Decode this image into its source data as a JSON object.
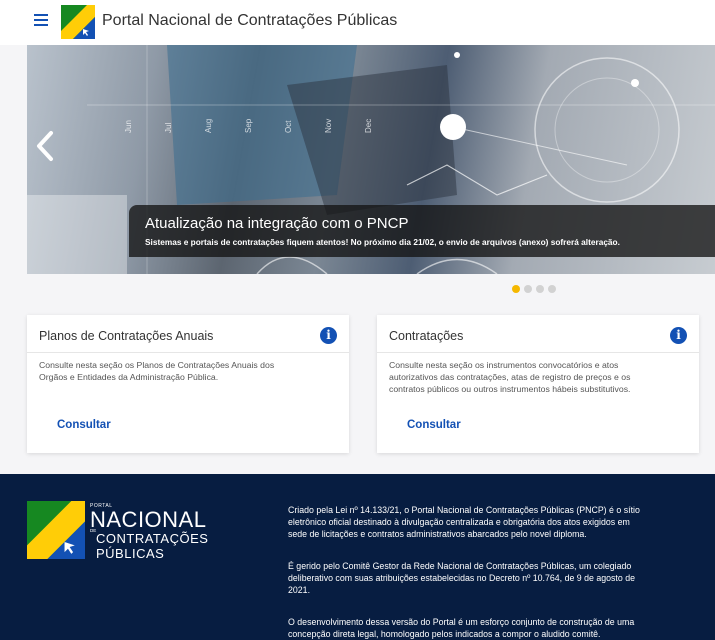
{
  "header": {
    "menu_icon": "hamburger-menu-icon",
    "logo_icon": "pncp-logo-icon",
    "title": "Portal Nacional de Contratações Públicas"
  },
  "carousel": {
    "month_labels": [
      "Jun",
      "Jul",
      "Aug",
      "Sep",
      "Oct",
      "Nov",
      "Dec"
    ],
    "slide_title": "Atualização na integração com o PNCP",
    "slide_text": "Sistemas e portais de contratações fiquem atentos! No próximo dia 21/02, o envio de arquivos (anexo) sofrerá alteração.",
    "prev_icon": "chevron-left-icon",
    "slide_count": 4,
    "active_slide": 1
  },
  "cards": [
    {
      "title": "Planos de Contratações Anuais",
      "description_lines": [
        "Consulte nesta seção os Planos de Contratações Anuais dos",
        "Orgãos e Entidades da Administração Pública."
      ],
      "link": "Consultar",
      "icon": "info-icon"
    },
    {
      "title": "Contratações",
      "description_lines": [
        "Consulte nesta seção os instrumentos convocatórios e atos",
        "autorizativos das contratações, atas de registro de preços e os",
        "contratos públicos ou outros instrumentos hábeis substitutivos."
      ],
      "link": "Consultar",
      "icon": "info-icon"
    }
  ],
  "footer": {
    "brand": {
      "portal": "PORTAL",
      "nacional": "NACIONAL",
      "de": "DE",
      "contratacoes": "CONTRATAÇÕES",
      "publicas": "PÚBLICAS"
    },
    "paragraphs": [
      [
        "Criado pela Lei nº 14.133/21, o Portal Nacional de Contratações Públicas (PNCP) é o sítio",
        "eletrônico oficial destinado à divulgação centralizada e obrigatória dos atos exigidos em",
        "sede de licitações e contratos administrativos abarcados pelo novel diploma."
      ],
      [
        "É gerido pelo Comitê Gestor da Rede Nacional de Contratações Públicas, um colegiado",
        "deliberativo com suas atribuições estabelecidas no Decreto nº 10.764, de 9 de agosto de",
        "2021."
      ],
      [
        "O desenvolvimento dessa versão do Portal é um esforço conjunto de construção de uma",
        "concepção direta legal, homologado pelos indicados a compor o aludido comitê."
      ]
    ]
  },
  "colors": {
    "primary_blue": "#1351b4",
    "footer_bg": "#071d41",
    "active_dot": "#f5b800",
    "logo_green": "#168821",
    "logo_yellow": "#ffcd07"
  }
}
